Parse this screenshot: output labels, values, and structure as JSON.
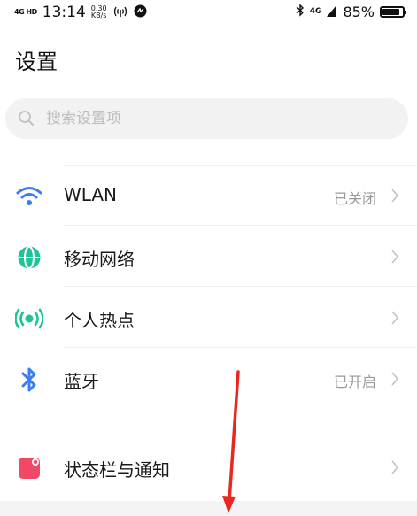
{
  "status_bar": {
    "network": "4G HD",
    "time": "13:14",
    "speed_value": "0.30",
    "speed_unit": "KB/s",
    "right_network": "4G",
    "battery_text": "85%",
    "battery_level": 0.85
  },
  "page": {
    "title": "设置"
  },
  "search": {
    "placeholder": "搜索设置项"
  },
  "settings": {
    "wlan": {
      "label": "WLAN",
      "value": "已关闭",
      "icon": "wifi-icon",
      "color": "#3b7df5"
    },
    "mobile": {
      "label": "移动网络",
      "icon": "globe-icon",
      "color": "#1fc39a"
    },
    "hotspot": {
      "label": "个人热点",
      "icon": "hotspot-icon",
      "color": "#1fc39a"
    },
    "bluetooth": {
      "label": "蓝牙",
      "value": "已开启",
      "icon": "bluetooth-icon",
      "color": "#3b7df5"
    },
    "statusbar": {
      "label": "状态栏与通知",
      "icon": "notification-icon",
      "color": "#f24867"
    }
  },
  "annotation": {
    "arrow_color": "#e8281f"
  }
}
